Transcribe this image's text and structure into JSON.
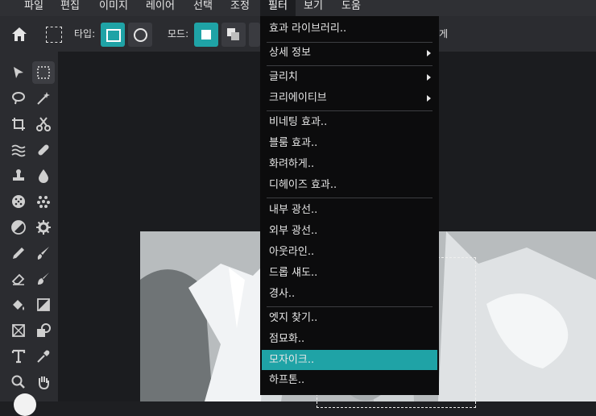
{
  "menubar": {
    "items": [
      "파일",
      "편집",
      "이미지",
      "레이어",
      "선택",
      "조정",
      "필터",
      "보기",
      "도움"
    ],
    "active": "필터"
  },
  "options": {
    "home_icon": "home-icon",
    "type_label": "타입:",
    "mode_label": "모드:",
    "hidden_partial_text": "부드럽게"
  },
  "filter_menu": {
    "items": [
      {
        "label": "효과 라이브러리..",
        "submenu": false
      },
      {
        "label": "상세 정보",
        "submenu": true
      },
      {
        "label": "글리치",
        "submenu": true
      },
      {
        "label": "크리에이티브",
        "submenu": true
      },
      {
        "label": "비네팅 효과..",
        "submenu": false
      },
      {
        "label": "블룸 효과..",
        "submenu": false
      },
      {
        "label": "화려하게..",
        "submenu": false
      },
      {
        "label": "디헤이즈 효과..",
        "submenu": false
      },
      {
        "label": "내부 광선..",
        "submenu": false
      },
      {
        "label": "외부 광선..",
        "submenu": false
      },
      {
        "label": "아웃라인..",
        "submenu": false
      },
      {
        "label": "드롭 섀도..",
        "submenu": false
      },
      {
        "label": "경사..",
        "submenu": false
      },
      {
        "label": "엣지 찾기..",
        "submenu": false
      },
      {
        "label": "점묘화..",
        "submenu": false
      },
      {
        "label": "모자이크..",
        "submenu": false,
        "highlighted": true
      },
      {
        "label": "하프톤..",
        "submenu": false
      }
    ]
  },
  "colors": {
    "accent": "#1fa3a6",
    "menu_bg": "#0c0c0d",
    "toolbar_bg": "#2b2c30"
  }
}
